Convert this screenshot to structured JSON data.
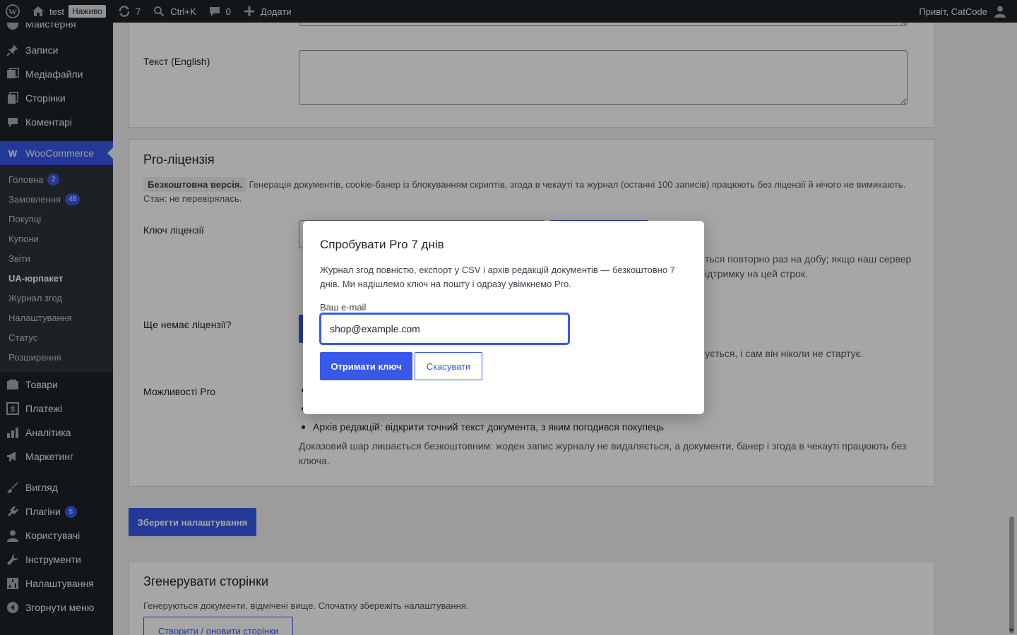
{
  "adminbar": {
    "site_name": "test",
    "live_badge": "Наживо",
    "updates_count": "7",
    "search_shortcut": "Ctrl+K",
    "comments_count": "0",
    "add_new": "Додати",
    "greeting": "Привіт, CatCode"
  },
  "sidebar": {
    "partial_top": "Майстерня",
    "items": {
      "posts": "Записи",
      "media": "Медіафайли",
      "pages": "Сторінки",
      "comments": "Коментарі",
      "woocommerce": "WooCommerce",
      "products": "Товари",
      "payments": "Платежі",
      "analytics": "Аналітика",
      "marketing": "Маркетинг",
      "appearance": "Вигляд",
      "plugins": "Плагіни",
      "plugins_count": "5",
      "users": "Користувачі",
      "tools": "Інструменти",
      "settings": "Налаштування",
      "collapse": "Згорнути меню"
    },
    "submenu": {
      "home": "Головна",
      "home_count": "2",
      "orders": "Замовлення",
      "orders_count": "48",
      "customers": "Покупці",
      "coupons": "Купони",
      "reports": "Звіти",
      "ua_pack": "UA-юрпакет",
      "consent_log": "Журнал згод",
      "settings": "Налаштування",
      "status": "Статус",
      "extensions": "Розширення"
    }
  },
  "main": {
    "text_english_label": "Текст (English)",
    "pro": {
      "title": "Pro-ліцензія",
      "free_tag": "Безкоштовна версія.",
      "free_desc": "Генерація документів, cookie-банер із блокуванням скриптів, згода в чекауті та журнал (останні 100 записів) працюють без ліцензії й нічого не вимикають.",
      "status": "Стан: не перевірялась.",
      "key_label": "Ключ ліцензії",
      "key_desc_right_1": "ться повторно раз на добу; якщо наш сервер",
      "key_desc_right_2": "ідтримку на цей строк.",
      "no_license_label": "Ще немає ліцензії?",
      "no_license_desc_right": "ується, і сам він ніколи не стартує.",
      "features_label": "Можливості Pro",
      "feature_archive": "Архів редакцій: відкрити точний текст документа, з яким погодився покупець",
      "proof_note": "Доказовий шар лишається безкоштовним: жоден запис журналу не видаляється, а документи, банер і згода в чекауті працюють без ключа."
    },
    "save_button": "Зберегти налаштування",
    "generate": {
      "title": "Згенерувати сторінки",
      "desc": "Генеруються документи, відмічені вище. Спочатку збережіть налаштування.",
      "button": "Створити / оновити сторінки"
    }
  },
  "modal": {
    "title": "Спробувати Pro 7 днів",
    "desc": "Журнал згод повністю, експорт у CSV і архів редакцій документів — безкоштовно 7 днів. Ми надішлемо ключ на пошту і одразу увімкнемо Pro.",
    "email_label": "Ваш e-mail",
    "email_value": "shop@example.com",
    "get_key": "Отримати ключ",
    "cancel": "Скасувати"
  }
}
